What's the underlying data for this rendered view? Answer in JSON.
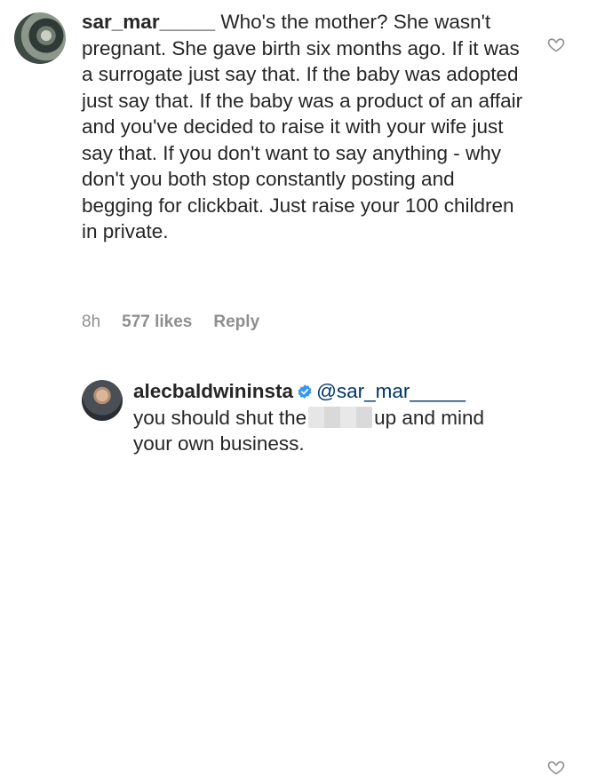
{
  "comment1": {
    "username": "sar_mar_____",
    "text": "Who's the mother? She wasn't pregnant. She gave birth six months ago. If it was a surrogate just say that. If the baby was adopted just say that. If the baby was a product of an affair and you've decided to raise it with your wife just say that. If you don't want to say anything - why don't you both stop constantly posting and begging for clickbait. Just raise your 100 children in private.",
    "time": "8h",
    "likes": "577 likes",
    "reply_label": "Reply",
    "like_icon": "heart-outline-icon"
  },
  "comment2": {
    "username": "alecbaldwininsta",
    "mention": "@sar_mar_____",
    "text_before": "you should shut the",
    "text_after": "up and mind your own business.",
    "verified_icon": "verified-badge-icon",
    "like_icon": "heart-outline-icon"
  },
  "colors": {
    "text": "#262626",
    "secondary": "#8e8e8e",
    "mention": "#00376b",
    "verified": "#3897f0"
  }
}
